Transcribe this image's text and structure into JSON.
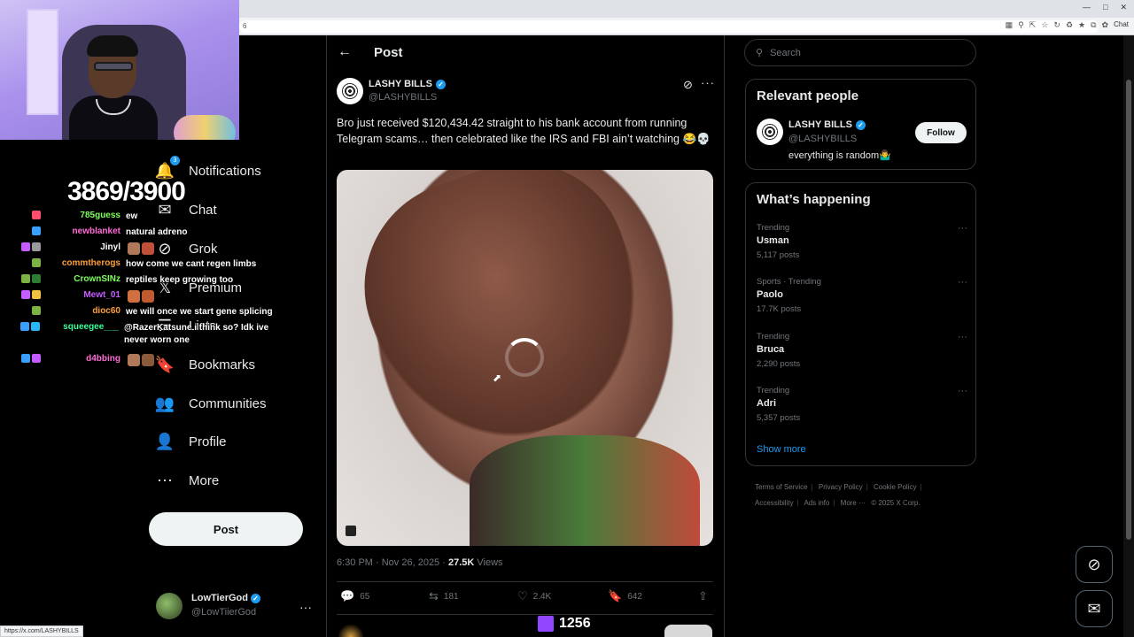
{
  "browser": {
    "url_fragment": "6",
    "chat_label": "Chat",
    "status_url": "https://x.com/LASHYBILLS"
  },
  "nav": {
    "notifications": {
      "label": "Notifications",
      "badge": "3"
    },
    "chat": {
      "label": "Chat"
    },
    "grok": {
      "label": "Grok"
    },
    "premium": {
      "label": "Premium"
    },
    "lists": {
      "label": "Lists"
    },
    "bookmarks": {
      "label": "Bookmarks"
    },
    "communities": {
      "label": "Communities"
    },
    "profile": {
      "label": "Profile"
    },
    "more": {
      "label": "More"
    },
    "post_button": "Post"
  },
  "account": {
    "name": "LowTierGod",
    "handle": "@LowTiierGod"
  },
  "overlay": {
    "counter": "3869/3900",
    "viewers": "1256",
    "chat": [
      {
        "user": "785guess",
        "color": "#7cff5a",
        "msg": "ew"
      },
      {
        "user": "newblanket",
        "color": "#ff6bd6",
        "msg": "natural adreno"
      },
      {
        "user": "Jinyl",
        "color": "#ffffff",
        "msg": ""
      },
      {
        "user": "commtherogs",
        "color": "#ff9f3a",
        "msg": "how come we cant regen limbs"
      },
      {
        "user": "CrownSINz",
        "color": "#7cff5a",
        "msg": "reptiles keep growing too"
      },
      {
        "user": "Mewt_01",
        "color": "#c45cff",
        "msg": ""
      },
      {
        "user": "dioc60",
        "color": "#ff9f3a",
        "msg": "we will once we start gene splicing"
      },
      {
        "user": "squeegee___",
        "color": "#3aff9a",
        "msg": "@RazerKatsune i think so? Idk ive never worn one"
      },
      {
        "user": "d4bbing",
        "color": "#ff6bd6",
        "msg": ""
      }
    ]
  },
  "post": {
    "header_title": "Post",
    "author_name": "LASHY BILLS",
    "author_handle": "@LASHYBILLS",
    "text": "Bro just received $120,434.42 straight to his bank account from running Telegram scams… then celebrated like the IRS and FBI ain’t watching 😂💀",
    "time": "6:30 PM · Nov 26, 2025 · ",
    "views_count": "27.5K",
    "views_label": " Views",
    "replies": "65",
    "reposts": "181",
    "likes": "2.4K",
    "bookmarks": "642"
  },
  "sidebar": {
    "search_placeholder": "Search",
    "relevant_title": "Relevant people",
    "relevant_person": {
      "name": "LASHY BILLS",
      "handle": "@LASHYBILLS",
      "bio": "everything is random🤷‍♂️",
      "follow_label": "Follow"
    },
    "happening_title": "What’s happening",
    "trends": [
      {
        "context": "Trending",
        "topic": "Usman",
        "count": "5,117 posts"
      },
      {
        "context": "Sports · Trending",
        "topic": "Paolo",
        "count": "17.7K posts"
      },
      {
        "context": "Trending",
        "topic": "Bruca",
        "count": "2,290 posts"
      },
      {
        "context": "Trending",
        "topic": "Adri",
        "count": "5,357 posts"
      }
    ],
    "show_more": "Show more"
  },
  "footer": {
    "terms": "Terms of Service",
    "privacy": "Privacy Policy",
    "cookie": "Cookie Policy",
    "accessibility": "Accessibility",
    "ads": "Ads info",
    "more": "More ···",
    "copyright": "© 2025 X Corp."
  }
}
